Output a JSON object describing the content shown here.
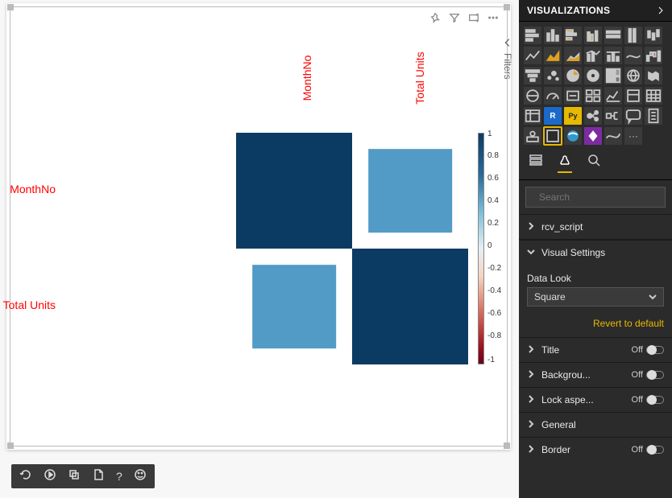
{
  "canvas": {
    "actions": {
      "pin": "pin-icon",
      "filter": "filter-icon",
      "focus": "focus-icon",
      "more": "more-icon"
    }
  },
  "chart_data": {
    "type": "heatmap",
    "labels": [
      "MonthNo",
      "Total Units"
    ],
    "matrix": [
      [
        1.0,
        0.75
      ],
      [
        0.75,
        1.0
      ]
    ],
    "layout": "square",
    "colorbar": {
      "min": -1,
      "max": 1,
      "ticks": [
        "1",
        "0.8",
        "0.6",
        "0.4",
        "0.2",
        "0",
        "-0.2",
        "-0.4",
        "-0.6",
        "-0.8",
        "-1"
      ]
    }
  },
  "filters_tab": {
    "label": "Filters"
  },
  "bottom_bar": {
    "items": [
      {
        "name": "refresh-icon"
      },
      {
        "name": "play-icon"
      },
      {
        "name": "duplicate-icon"
      },
      {
        "name": "new-page-icon"
      },
      {
        "name": "help-icon",
        "text": "?"
      },
      {
        "name": "smiley-icon"
      }
    ]
  },
  "viz_panel": {
    "title": "VISUALIZATIONS",
    "gallery_names": [
      "stacked-bar",
      "stacked-column",
      "clustered-bar",
      "clustered-column",
      "hundred-bar",
      "hundred-column",
      "range-column",
      "line",
      "area",
      "stacked-area",
      "combo-col-line",
      "combo-col-line2",
      "ribbon",
      "waterfall",
      "funnel",
      "scatter",
      "pie",
      "donut",
      "treemap",
      "map",
      "filled-map",
      "shape-map",
      "gauge",
      "card",
      "multi-card",
      "kpi",
      "slicer",
      "table",
      "matrix",
      "r-visual",
      "py-visual",
      "key-influencers",
      "decomp-tree",
      "qna",
      "paginated",
      "arcgis",
      "custom",
      "globe",
      "ppl-visual",
      "spark",
      "more-visuals"
    ],
    "gallery_py_label": "Py",
    "gallery_r_label": "R",
    "gallery_more": "···",
    "tabs": {
      "fields": "fields-tab",
      "format": "format-tab",
      "analytics": "analytics-tab"
    },
    "search_placeholder": "Search",
    "groups": {
      "rcv_script": "rcv_script",
      "visual_settings": "Visual Settings",
      "data_look_label": "Data Look",
      "data_look_value": "Square",
      "revert": "Revert to default",
      "title": "Title",
      "background": "Backgrou...",
      "lock_aspect": "Lock aspe...",
      "general": "General",
      "border": "Border",
      "off": "Off"
    }
  }
}
